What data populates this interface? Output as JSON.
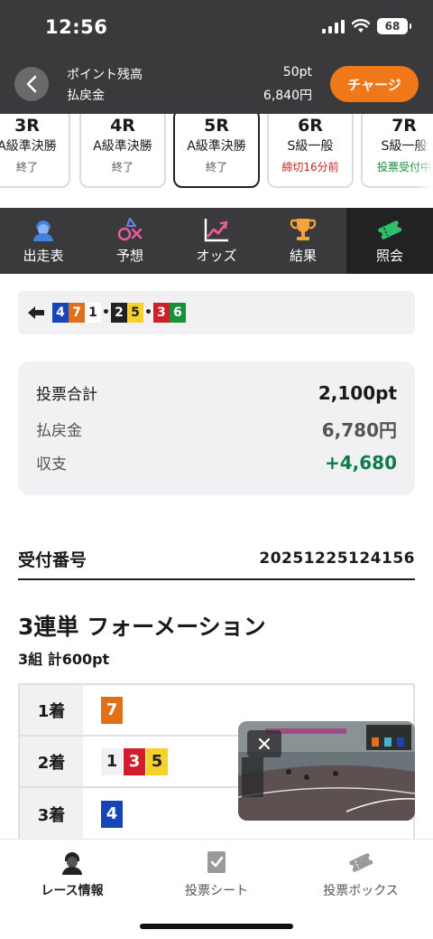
{
  "status": {
    "time": "12:56",
    "battery": "68"
  },
  "header": {
    "points_label": "ポイント残高",
    "points_value": "50pt",
    "refund_label": "払戻金",
    "refund_value": "6,840円",
    "charge_label": "チャージ"
  },
  "races": [
    {
      "num": "3R",
      "class": "A級準決勝",
      "status": "終了",
      "status_color": "gray"
    },
    {
      "num": "4R",
      "class": "A級準決勝",
      "status": "終了",
      "status_color": "gray"
    },
    {
      "num": "5R",
      "class": "A級準決勝",
      "status": "終了",
      "status_color": "gray",
      "active": true
    },
    {
      "num": "6R",
      "class": "S級一般",
      "status": "締切16分前",
      "status_color": "red"
    },
    {
      "num": "7R",
      "class": "S級一般",
      "status": "投票受付中",
      "status_color": "green"
    }
  ],
  "nav": [
    {
      "label": "出走表",
      "icon": "racer-icon"
    },
    {
      "label": "予想",
      "icon": "prediction-icon"
    },
    {
      "label": "オッズ",
      "icon": "odds-chart-icon"
    },
    {
      "label": "結果",
      "icon": "trophy-icon"
    },
    {
      "label": "照会",
      "icon": "ticket-icon",
      "active": true
    }
  ],
  "combo": [
    {
      "n": "4",
      "bg": "#1645b8",
      "fg": "#ffffff"
    },
    {
      "n": "7",
      "bg": "#e0701a",
      "fg": "#ffffff"
    },
    {
      "n": "1",
      "bg": "#ffffff",
      "fg": "#222222"
    },
    {
      "sep": "•"
    },
    {
      "n": "2",
      "bg": "#222222",
      "fg": "#ffffff"
    },
    {
      "n": "5",
      "bg": "#f5d12a",
      "fg": "#222222"
    },
    {
      "sep": "•"
    },
    {
      "n": "3",
      "bg": "#d11e2c",
      "fg": "#ffffff"
    },
    {
      "n": "6",
      "bg": "#18903c",
      "fg": "#ffffff"
    }
  ],
  "summary": {
    "total_label": "投票合計",
    "total_value": "2,100pt",
    "payout_label": "払戻金",
    "payout_value": "6,780円",
    "balance_label": "収支",
    "balance_value": "+4,680"
  },
  "receipt": {
    "label": "受付番号",
    "value": "20251225124156"
  },
  "bet": {
    "title": "3連単 フォーメーション",
    "subtitle": "3組 計600pt",
    "rows": [
      {
        "pos": "1着",
        "chips": [
          {
            "n": "7",
            "bg": "#e0701a",
            "fg": "#ffffff"
          }
        ]
      },
      {
        "pos": "2着",
        "chips": [
          {
            "n": "1",
            "bg": "#f1f1f4",
            "fg": "#222222"
          },
          {
            "n": "3",
            "bg": "#d11e2c",
            "fg": "#ffffff"
          },
          {
            "n": "5",
            "bg": "#f5d12a",
            "fg": "#222222"
          }
        ]
      },
      {
        "pos": "3着",
        "chips": [
          {
            "n": "4",
            "bg": "#1645b8",
            "fg": "#ffffff"
          }
        ]
      }
    ]
  },
  "bottom_nav": [
    {
      "label": "レース情報",
      "icon": "racer-icon",
      "active": true
    },
    {
      "label": "投票シート",
      "icon": "sheet-check-icon"
    },
    {
      "label": "投票ボックス",
      "icon": "ticket-box-icon"
    }
  ]
}
